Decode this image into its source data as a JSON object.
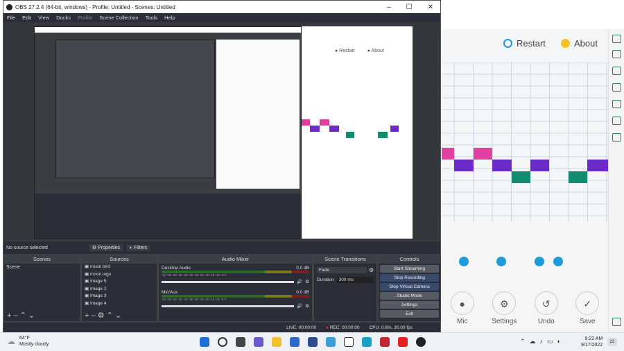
{
  "obs": {
    "title": "OBS 27.2.4 (64-bit, windows) - Profile: Untitled - Scenes: Untitled",
    "menu": [
      "File",
      "Edit",
      "View",
      "Docks",
      "Profile",
      "Scene Collection",
      "Tools",
      "Help"
    ],
    "no_source": "No source selected",
    "properties_label": "Properties",
    "filters_label": "Filters",
    "docks": {
      "scenes": {
        "title": "Scenes",
        "items": [
          "Scene"
        ]
      },
      "sources": {
        "title": "Sources",
        "items": [
          "moon bird",
          "moon logo",
          "Image 5",
          "Image 2",
          "Image 3",
          "Image 4"
        ]
      },
      "mixer": {
        "title": "Audio Mixer",
        "channels": [
          {
            "name": "Desktop Audio",
            "db": "0.0 dB"
          },
          {
            "name": "Mic/Aux",
            "db": "0.0 dB"
          }
        ],
        "scale": "-60 -55 -50 -45 -40 -35 -30 -25 -20 -15 -10 -5 0"
      },
      "transitions": {
        "title": "Scene Transitions",
        "type": "Fade",
        "duration_label": "Duration",
        "duration": "300 ms"
      },
      "controls": {
        "title": "Controls",
        "buttons": [
          "Start Streaming",
          "Stop Recording",
          "Stop Virtual Camera",
          "Studio Mode",
          "Settings",
          "Exit"
        ]
      }
    },
    "status": {
      "live": "LIVE: 00:00:00",
      "rec": "REC: 00:00:00",
      "cpu": "CPU: 0.6%, 30.00 fps"
    }
  },
  "app": {
    "restart": "Restart",
    "about": "About",
    "actions": [
      {
        "label": "Mic",
        "icon": "mic-icon"
      },
      {
        "label": "Settings",
        "icon": "gear-icon"
      },
      {
        "label": "Undo",
        "icon": "undo-icon"
      },
      {
        "label": "Save",
        "icon": "check-icon"
      }
    ]
  },
  "taskbar": {
    "weather_temp": "64°F",
    "weather_desc": "Mostly cloudy",
    "time": "9:22 AM",
    "date": "9/17/2022",
    "badge": "22"
  },
  "colors": {
    "pink": "#e040a0",
    "purple": "#6a2bc8",
    "teal": "#138a72",
    "blue": "#1e9ad6",
    "obs_dark": "#2b2e38"
  }
}
